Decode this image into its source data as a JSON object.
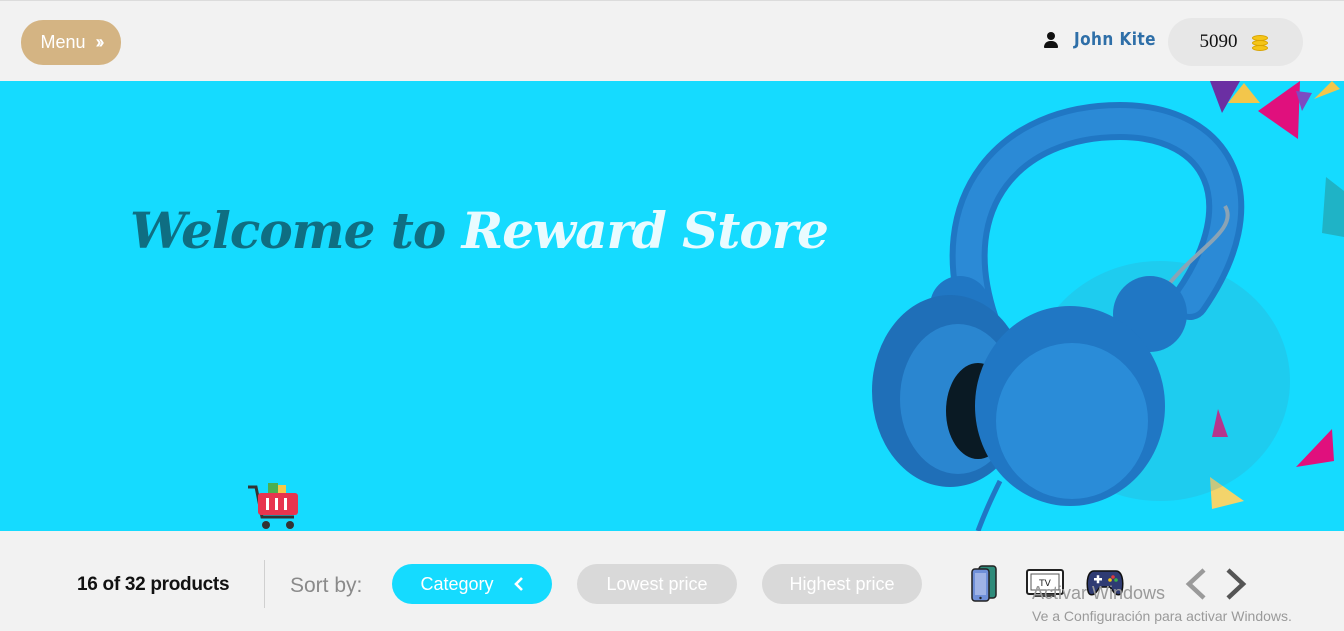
{
  "header": {
    "menu_label": "Menu",
    "user_name": "John Kite",
    "points": "5090"
  },
  "banner": {
    "welcome_prefix": "Welcome to",
    "welcome_brand": "Reward Store"
  },
  "filters": {
    "count_text": "16 of 32 products",
    "sort_label": "Sort by:",
    "options": [
      "Category",
      "Lowest price",
      "Highest price"
    ],
    "active_option": "Category",
    "categories": [
      "phone-icon",
      "tv-icon",
      "gamepad-icon"
    ]
  },
  "watermark": {
    "line1": "Activar Windows",
    "line2": "Ve a Configuración para activar Windows."
  },
  "colors": {
    "accent": "#15dbff",
    "menu_button": "#d4b483",
    "user_name": "#2f6fa8",
    "pill_inactive": "#d9d9d9"
  }
}
